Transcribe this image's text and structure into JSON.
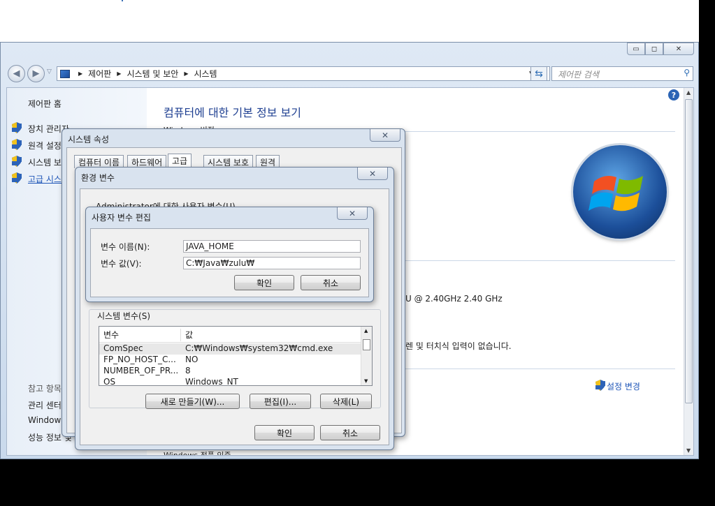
{
  "window": {
    "min_glyph": "▭",
    "max_glyph": "◻",
    "close_glyph": "✕"
  },
  "nav": {
    "back": "◀",
    "forward": "▶",
    "dropdown": "▽"
  },
  "address": {
    "parts": [
      "제어판",
      "시스템 및 보안",
      "시스템"
    ],
    "dropdown": "▼",
    "refresh": "⇆"
  },
  "search": {
    "placeholder": "제어판 검색",
    "icon": "⚲"
  },
  "sidebar": {
    "home": "제어판 홈",
    "items": [
      {
        "label": "장치 관리자"
      },
      {
        "label": "원격 설정"
      },
      {
        "label": "시스템 보호"
      },
      {
        "label": "고급 시스템 설정"
      }
    ],
    "see_also": "참고 항목",
    "see_also_items": [
      {
        "label": "관리 센터"
      },
      {
        "label": "Windows Update"
      },
      {
        "label": "성능 정보 및 도구"
      }
    ]
  },
  "main": {
    "title": "컴퓨터에 대한 기본 정보 보기",
    "section_windows": "Windows 버전",
    "cpu_text": "U @ 2.40GHz   2.40 GHz",
    "pen_text": "렌 및 터치식 입력이 없습니다.",
    "change_settings": "설정 변경",
    "activation": "Windows 정품 인증",
    "help": "?"
  },
  "sys_props": {
    "title": "시스템 속성",
    "close": "✕",
    "tabs": [
      "컴퓨터 이름",
      "하드웨어",
      "고급",
      "시스템 보호",
      "원격"
    ],
    "active_tab": 2
  },
  "env_vars": {
    "title": "환경 변수",
    "close": "✕",
    "user_section": "Administrator에 대한 사용자 변수(U)",
    "system_section": "시스템 변수(S)",
    "grid_headers": [
      "변수",
      "값"
    ],
    "rows": [
      {
        "name": "ComSpec",
        "value": "C:₩Windows₩system32₩cmd.exe"
      },
      {
        "name": "FP_NO_HOST_C...",
        "value": "NO"
      },
      {
        "name": "NUMBER_OF_PR...",
        "value": "8"
      },
      {
        "name": "OS",
        "value": "Windows_NT"
      }
    ],
    "new_btn": "새로 만들기(W)...",
    "edit_btn": "편집(I)...",
    "delete_btn": "삭제(L)",
    "ok": "확인",
    "cancel": "취소"
  },
  "edit_var": {
    "title": "사용자 변수 편집",
    "close": "✕",
    "name_label": "변수 이름(N):",
    "name_value": "JAVA_HOME",
    "value_label": "변수 값(V):",
    "value_value": "C:₩Java₩zulu₩",
    "ok": "확인",
    "cancel": "취소"
  }
}
